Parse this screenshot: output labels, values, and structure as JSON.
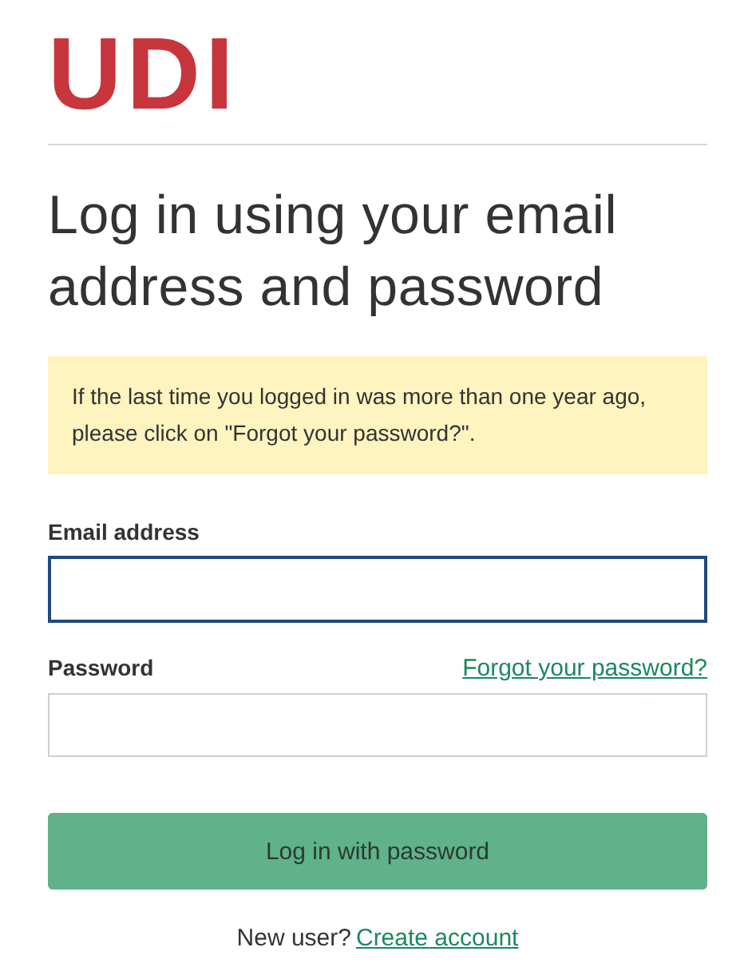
{
  "logo": "UDI",
  "heading": "Log in using your email address and password",
  "notice": "If the last time you logged in was more than one year ago, please click on \"Forgot your password?\".",
  "email": {
    "label": "Email address",
    "focused": true
  },
  "password": {
    "label": "Password",
    "forgot_link": "Forgot your password?",
    "focused": false
  },
  "submit_button": "Log in with password",
  "footer": {
    "text": "New user?",
    "link": "Create account"
  }
}
